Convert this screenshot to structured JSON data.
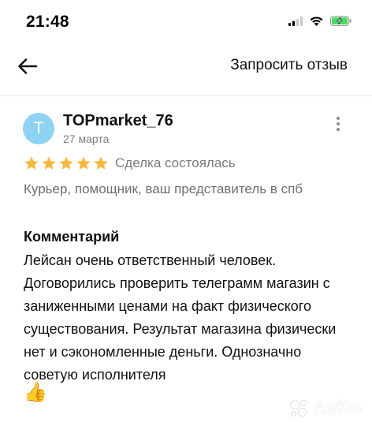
{
  "status_bar": {
    "time": "21:48",
    "icons": [
      "signal-icon",
      "wifi-icon",
      "battery-charging-icon"
    ]
  },
  "nav": {
    "back_icon": "arrow-left-icon",
    "request_review_label": "Запросить отзыв"
  },
  "review": {
    "avatar_letter": "T",
    "avatar_color": "#8fd3f2",
    "user_name": "TOPmarket_76",
    "date": "27 марта",
    "rating": 5,
    "star_color": "#f5b83d",
    "deal_status": "Сделка состоялась",
    "role": "Курьер, помощник, ваш представитель в спб",
    "comment_title": "Комментарий",
    "comment_text": "Лейсан очень ответственный человек. Договорились проверить телеграмм магазин с заниженными ценами на факт физического существования. Результат магазина физически нет и сэкономленные деньги. Однозначно советую исполнителя",
    "emoji": "👍"
  },
  "watermark": {
    "text": "Avito"
  }
}
